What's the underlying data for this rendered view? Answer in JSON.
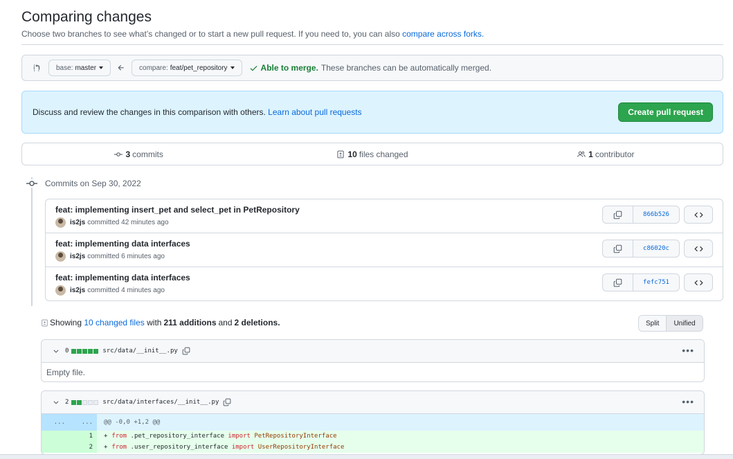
{
  "header": {
    "title": "Comparing changes",
    "subtitle": "Choose two branches to see what’s changed or to start a new pull request. If you need to, you can also",
    "subtitle_link": "compare across forks."
  },
  "range": {
    "base_prefix": "base:",
    "base_branch": "master",
    "compare_prefix": "compare:",
    "compare_branch": "feat/pet_repository",
    "merge_ok": "Able to merge.",
    "merge_text": "These branches can be automatically merged."
  },
  "flash": {
    "text": "Discuss and review the changes in this comparison with others.",
    "link": "Learn about pull requests",
    "button": "Create pull request"
  },
  "summary": {
    "commits_count": "3",
    "commits_label": "commits",
    "files_count": "10",
    "files_label": "files changed",
    "contrib_count": "1",
    "contrib_label": "contributor"
  },
  "commits": {
    "date": "Commits on Sep 30, 2022",
    "items": [
      {
        "title": "feat: implementing insert_pet and select_pet in PetRepository",
        "author": "is2js",
        "time": "committed 42 minutes ago",
        "sha": "866b526"
      },
      {
        "title": "feat: implementing data interfaces",
        "author": "is2js",
        "time": "committed 6 minutes ago",
        "sha": "c86020c"
      },
      {
        "title": "feat: implementing data interfaces",
        "author": "is2js",
        "time": "committed 4 minutes ago",
        "sha": "fefc751"
      }
    ]
  },
  "files_summary": {
    "prefix": "Showing",
    "changed_link": "10 changed files",
    "with": "with",
    "additions": "211 additions",
    "and": "and",
    "deletions": "2 deletions.",
    "split": "Split",
    "unified": "Unified"
  },
  "files": [
    {
      "count": "0",
      "path": "src/data/__init__.py",
      "empty": "Empty file."
    },
    {
      "count": "2",
      "path": "src/data/interfaces/__init__.py",
      "hunk_left": "...",
      "hunk_right": "...",
      "hunk": "@@ -0,0 +1,2 @@",
      "lines": [
        {
          "num": "1",
          "kw1": "from",
          "mod": " .pet_repository_interface ",
          "kw2": "import",
          "cls": " PetRepositoryInterface"
        },
        {
          "num": "2",
          "kw1": "from",
          "mod": " .user_repository_interface ",
          "kw2": "import",
          "cls": " UserRepositoryInterface"
        }
      ]
    }
  ],
  "colors": {
    "accent": "#0969da",
    "success": "#2da44e",
    "flash_bg": "#ddf4ff",
    "add_bg": "#e6ffec"
  },
  "icons": [
    "compare-arrows-icon",
    "arrow-left-icon",
    "check-icon",
    "commit-icon",
    "file-diff-icon",
    "people-icon",
    "copy-icon",
    "code-icon",
    "chevron-down-icon",
    "kebab-icon"
  ]
}
